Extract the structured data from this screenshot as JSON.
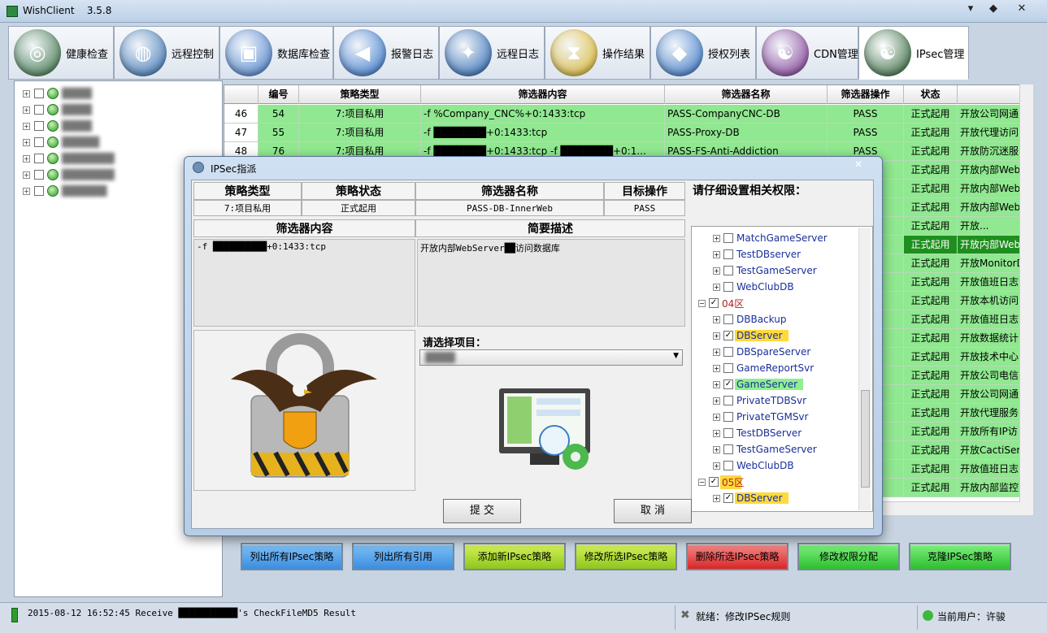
{
  "window": {
    "title": "WishClient",
    "version": "3.5.8",
    "min": "▾",
    "max": "◆",
    "close": "✕"
  },
  "toolbar": [
    {
      "label": "健康检查",
      "icon": "radar-icon",
      "color": "#2e6b3a"
    },
    {
      "label": "远程控制",
      "icon": "globe-icon",
      "color": "#2f6db0"
    },
    {
      "label": "数据库检查",
      "icon": "database-monitor-icon",
      "color": "#3f79c8"
    },
    {
      "label": "报警日志",
      "icon": "megaphone-icon",
      "color": "#2a6fc9"
    },
    {
      "label": "远程日志",
      "icon": "wrench-globe-icon",
      "color": "#1e5fae"
    },
    {
      "label": "操作结果",
      "icon": "hourglass-icon",
      "color": "#d9b21e"
    },
    {
      "label": "授权列表",
      "icon": "cube-icon",
      "color": "#2c6fc4"
    },
    {
      "label": "CDN管理",
      "icon": "yinyang-icon",
      "color": "#7a2f8f"
    },
    {
      "label": "IPsec管理",
      "icon": "yinyang-green-icon",
      "color": "#1f5a2c"
    }
  ],
  "tree_items": [
    "████",
    "████",
    "████",
    "█████",
    "███████",
    "███████",
    "██████"
  ],
  "grid": {
    "headers": [
      "",
      "编号",
      "策略类型",
      "筛选器内容",
      "筛选器名称",
      "筛选器操作",
      "状态",
      ""
    ],
    "rows": [
      [
        "46",
        "54",
        "7:项目私用",
        "-f %Company_CNC%+0:1433:tcp",
        "PASS-CompanyCNC-DB",
        "PASS",
        "正式起用",
        "开放公司网通"
      ],
      [
        "47",
        "55",
        "7:项目私用",
        "-f ███████+0:1433:tcp",
        "PASS-Proxy-DB",
        "PASS",
        "正式起用",
        "开放代理访问"
      ],
      [
        "48",
        "76",
        "7:项目私用",
        "-f ███████+0:1433:tcp -f ███████+0:1...",
        "PASS-FS-Anti-Addiction",
        "PASS",
        "正式起用",
        "开放防沉迷服"
      ],
      [
        "",
        "",
        "",
        "",
        "",
        "",
        "正式起用",
        "开放内部Web"
      ],
      [
        "",
        "",
        "",
        "",
        "",
        "",
        "正式起用",
        "开放内部Web"
      ],
      [
        "",
        "",
        "",
        "",
        "",
        "",
        "正式起用",
        "开放内部Web"
      ],
      [
        "",
        "",
        "",
        "",
        "",
        "",
        "正式起用",
        "开放..."
      ],
      [
        "",
        "",
        "",
        "",
        "",
        "",
        "正式起用",
        "开放内部Web"
      ],
      [
        "",
        "",
        "",
        "",
        "",
        "",
        "正式起用",
        "开放MonitorD"
      ],
      [
        "",
        "",
        "",
        "",
        "",
        "",
        "正式起用",
        "开放值班日志"
      ],
      [
        "",
        "",
        "",
        "",
        "",
        "",
        "正式起用",
        "开放本机访问"
      ],
      [
        "",
        "",
        "",
        "",
        "",
        "",
        "正式起用",
        "开放值班日志"
      ],
      [
        "",
        "",
        "",
        "",
        "",
        "",
        "正式起用",
        "开放数据统计"
      ],
      [
        "",
        "",
        "",
        "",
        "",
        "",
        "正式起用",
        "开放技术中心"
      ],
      [
        "",
        "",
        "",
        "",
        "",
        "",
        "正式起用",
        "开放公司电信"
      ],
      [
        "",
        "",
        "",
        "",
        "",
        "",
        "正式起用",
        "开放公司网通"
      ],
      [
        "",
        "",
        "",
        "",
        "",
        "",
        "正式起用",
        "开放代理服务"
      ],
      [
        "",
        "",
        "",
        "",
        "",
        "",
        "正式起用",
        "开放所有IP访"
      ],
      [
        "",
        "",
        "",
        "",
        "",
        "",
        "正式起用",
        "开放CactiServ"
      ],
      [
        "",
        "",
        "",
        "",
        "",
        "",
        "正式起用",
        "开放值班日志"
      ],
      [
        "",
        "",
        "",
        "",
        "",
        "",
        "正式起用",
        "开放内部监控"
      ]
    ]
  },
  "buttons": [
    {
      "label": "列出所有IPsec策略",
      "style": "blue"
    },
    {
      "label": "列出所有引用",
      "style": "blue"
    },
    {
      "label": "添加新IPsec策略",
      "style": "yg"
    },
    {
      "label": "修改所选IPsec策略",
      "style": "yg"
    },
    {
      "label": "删除所选IPsec策略",
      "style": "red"
    },
    {
      "label": "修改权限分配",
      "style": "green"
    },
    {
      "label": "克隆IPSec策略",
      "style": "green"
    }
  ],
  "status": {
    "log": "2015-08-12 16:52:45  Receive ███████████'s CheckFileMD5 Result",
    "state": "就绪：修改IPSec规则",
    "user": "当前用户：许骏"
  },
  "dialog": {
    "title": "IPSec指派",
    "close": "✕",
    "headers": {
      "type": "策略类型",
      "state": "策略状态",
      "name": "筛选器名称",
      "op": "目标操作",
      "perm": "请仔细设置相关权限：",
      "content": "筛选器内容",
      "desc": "简要描述",
      "project": "请选择项目："
    },
    "values": {
      "type": "7:项目私用",
      "state": "正式起用",
      "name": "PASS-DB-InnerWeb",
      "op": "PASS"
    },
    "content": "-f ██████████+0:1433:tcp",
    "desc": "开放内部WebServer██访问数据库",
    "project_value": "████",
    "submit": "提 交",
    "cancel": "取 消"
  },
  "perm_tree": [
    {
      "label": "MatchGameServer",
      "checked": false,
      "level": 2
    },
    {
      "label": "TestDBserver",
      "checked": false,
      "level": 2
    },
    {
      "label": "TestGameServer",
      "checked": false,
      "level": 2
    },
    {
      "label": "WebClubDB",
      "checked": false,
      "level": 2
    },
    {
      "label": "04区",
      "checked": true,
      "level": 1,
      "group": true
    },
    {
      "label": "DBBackup",
      "checked": false,
      "level": 2
    },
    {
      "label": "DBServer",
      "checked": true,
      "level": 2,
      "hl": "yellow"
    },
    {
      "label": "DBSpareServer",
      "checked": false,
      "level": 2
    },
    {
      "label": "GameReportSvr",
      "checked": false,
      "level": 2
    },
    {
      "label": "GameServer",
      "checked": true,
      "level": 2,
      "hl": "green"
    },
    {
      "label": "PrivateTDBSvr",
      "checked": false,
      "level": 2
    },
    {
      "label": "PrivateTGMSvr",
      "checked": false,
      "level": 2
    },
    {
      "label": "TestDBServer",
      "checked": false,
      "level": 2
    },
    {
      "label": "TestGameServer",
      "checked": false,
      "level": 2
    },
    {
      "label": "WebClubDB",
      "checked": false,
      "level": 2
    },
    {
      "label": "05区",
      "checked": true,
      "level": 1,
      "group": true,
      "hl": "yellow"
    },
    {
      "label": "DBServer",
      "checked": true,
      "level": 2,
      "hl": "yellow"
    }
  ]
}
